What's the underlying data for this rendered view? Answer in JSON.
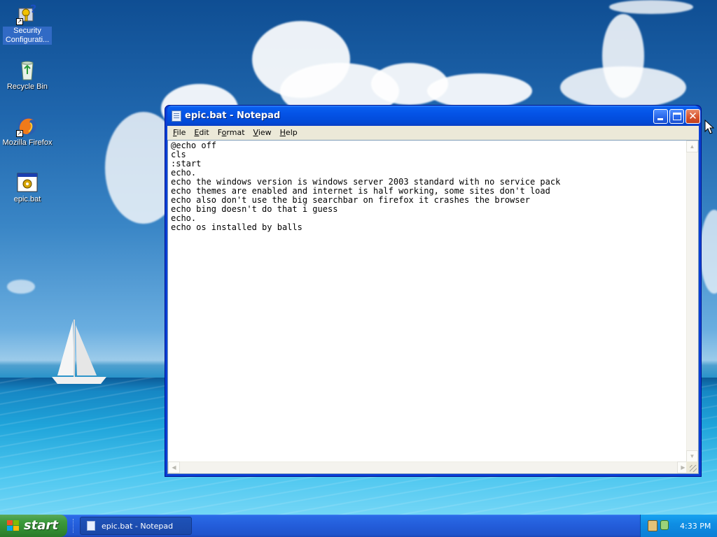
{
  "desktop": {
    "icons": [
      {
        "label": "Security Configurati...",
        "icon": "security-config-icon"
      },
      {
        "label": "Recycle Bin",
        "icon": "recycle-bin-icon"
      },
      {
        "label": "Mozilla Firefox",
        "icon": "firefox-icon"
      },
      {
        "label": "epic.bat",
        "icon": "batch-file-icon"
      }
    ]
  },
  "window": {
    "title": "epic.bat - Notepad",
    "menu": [
      {
        "label": "File",
        "accel": "F",
        "rest": "ile"
      },
      {
        "label": "Edit",
        "accel": "E",
        "rest": "dit"
      },
      {
        "label": "Format",
        "accel": "F",
        "rest": "ormat",
        "pre": ""
      },
      {
        "label": "View",
        "accel": "V",
        "rest": "iew"
      },
      {
        "label": "Help",
        "accel": "H",
        "rest": "elp"
      }
    ],
    "content": "@echo off\ncls\n:start\necho.\necho the windows version is windows server 2003 standard with no service pack\necho themes are enabled and internet is half working, some sites don't load\necho also don't use the big searchbar on firefox it crashes the browser\necho bing doesn't do that i guess\necho.\necho os installed by balls"
  },
  "taskbar": {
    "start_label": "start",
    "task_label": "epic.bat - Notepad",
    "clock": "4:33 PM"
  },
  "colors": {
    "titlebar": "#0453e6",
    "start": "#318a31",
    "taskbar": "#245edb",
    "tray": "#0f8ee4",
    "selection": "#316ac5"
  }
}
